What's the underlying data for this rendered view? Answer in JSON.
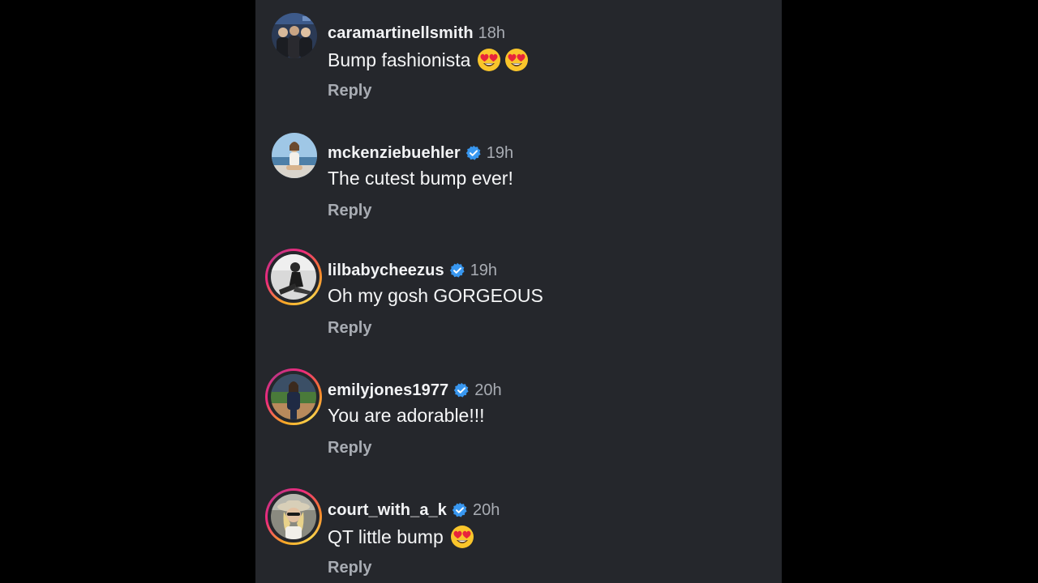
{
  "comments": [
    {
      "username": "caramartinellsmith",
      "verified": false,
      "time": "18h",
      "text": "Bump fashionista",
      "emojis": [
        "heart-eyes-emoji",
        "heart-eyes-emoji"
      ],
      "reply_label": "Reply",
      "story_ring": false
    },
    {
      "username": "mckenziebuehler",
      "verified": true,
      "time": "19h",
      "text": "The cutest bump ever!",
      "emojis": [],
      "reply_label": "Reply",
      "story_ring": false
    },
    {
      "username": "lilbabycheezus",
      "verified": true,
      "time": "19h",
      "text": "Oh my gosh GORGEOUS",
      "emojis": [],
      "reply_label": "Reply",
      "story_ring": true
    },
    {
      "username": "emilyjones1977",
      "verified": true,
      "time": "20h",
      "text": "You are adorable!!!",
      "emojis": [],
      "reply_label": "Reply",
      "story_ring": true
    },
    {
      "username": "court_with_a_k",
      "verified": true,
      "time": "20h",
      "text": "QT little bump",
      "emojis": [
        "heart-eyes-emoji"
      ],
      "reply_label": "Reply",
      "story_ring": true
    }
  ],
  "colors": {
    "panel_bg": "#25272c",
    "page_bg": "#000000",
    "username": "#f2f3f5",
    "secondary_text": "#a8acb3",
    "verified_blue": "#3897f0"
  }
}
